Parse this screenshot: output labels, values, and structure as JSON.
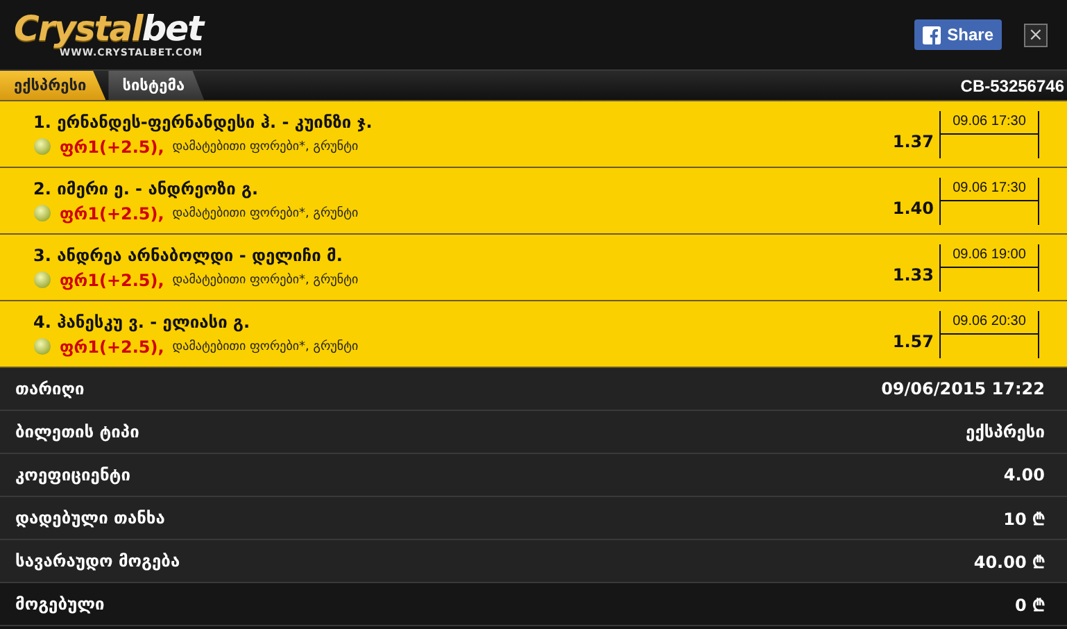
{
  "logo": {
    "name_1": "Crystal",
    "name_2": "bet",
    "url": "WWW.CRYSTALBET.COM"
  },
  "share_button": {
    "label": "Share"
  },
  "close_button": {
    "label": "×"
  },
  "tabs": [
    {
      "label": "ექსპრესი",
      "selected": true
    },
    {
      "label": "სისტემა",
      "selected": false
    }
  ],
  "ticket_id": "CB-53256746",
  "bets": [
    {
      "number": "1.",
      "match": "ერნანდეს-ფერნანდესი ჰ. - კუინზი ჯ.",
      "market": "ფრ1(+2.5),",
      "details": "დამატებითი ფორები*, გრუნტი",
      "odds": "1.37",
      "date": "09.06 17:30"
    },
    {
      "number": "2.",
      "match": "იმერი ე. - ანდრეოზი გ.",
      "market": "ფრ1(+2.5),",
      "details": "დამატებითი ფორები*, გრუნტი",
      "odds": "1.40",
      "date": "09.06 17:30"
    },
    {
      "number": "3.",
      "match": "ანდრეა არნაბოლდი - დელიჩი მ.",
      "market": "ფრ1(+2.5),",
      "details": "დამატებითი ფორები*, გრუნტი",
      "odds": "1.33",
      "date": "09.06 19:00"
    },
    {
      "number": "4.",
      "match": "ჰანესკუ ვ. - ელიასი გ.",
      "market": "ფრ1(+2.5),",
      "details": "დამატებითი ფორები*, გრუნტი",
      "odds": "1.57",
      "date": "09.06 20:30"
    }
  ],
  "summary": [
    {
      "label": "თარიღი",
      "value": "09/06/2015 17:22"
    },
    {
      "label": "ბილეთის ტიპი",
      "value": "ექსპრესი"
    },
    {
      "label": "კოეფიციენტი",
      "value": "4.00"
    },
    {
      "label": "დადებული თანხა",
      "value": "10 ₾"
    },
    {
      "label": "სავარაუდო მოგება",
      "value": "40.00 ₾"
    },
    {
      "label": "მოგებული",
      "value": "0 ₾"
    }
  ]
}
